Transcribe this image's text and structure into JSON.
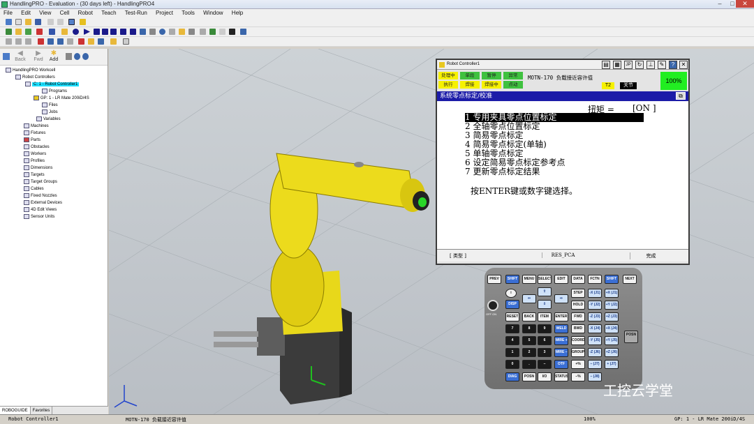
{
  "window": {
    "title": "HandlingPRO - Evaluation - (30 days left) - HandlingPRO4",
    "minimize": "–",
    "maximize": "□",
    "close": "✕"
  },
  "menu": [
    "File",
    "Edit",
    "View",
    "Cell",
    "Robot",
    "Teach",
    "Test-Run",
    "Project",
    "Tools",
    "Window",
    "Help"
  ],
  "nav": {
    "back": "Back",
    "fwd": "Fwd",
    "add": "Add"
  },
  "tree": {
    "workcell": "HandlingPRO Workcell",
    "robot_controllers": "Robot Controllers",
    "controller": "C: 1 - Robot Controller1",
    "programs": "Programs",
    "gp": "GP: 1 - LR Mate 200iD/4S",
    "files": "Files",
    "jobs": "Jobs",
    "variables": "Variables",
    "machines": "Machines",
    "fixtures": "Fixtures",
    "parts": "Parts",
    "obstacles": "Obstacles",
    "workers": "Workers",
    "profiles": "Profiles",
    "dimensions": "Dimensions",
    "targets": "Targets",
    "target_groups": "Target Groups",
    "cables": "Cables",
    "fixed_nozzles": "Fixed Nozzles",
    "external_devices": "External Devices",
    "edit_views": "4D Edit Views",
    "sensor_units": "Sensor Units"
  },
  "tabs": {
    "roboguide": "ROBOGUIDE",
    "favorites": "Favorites"
  },
  "tp": {
    "title": "Robot Controller1",
    "status": {
      "busy": "处理中",
      "step": "单段",
      "hold": "暂停",
      "fault": "异常",
      "run": "执行",
      "weld": "焊接",
      "welding": "焊接中",
      "jog": "点动"
    },
    "alarm": "MOTN-170 负载接近容许值",
    "t2": "T2",
    "mode": "关节",
    "override": "100%",
    "screen_title": "系统零点标定/校准",
    "torque_label": "扭矩 =",
    "torque_value": "[ON ]",
    "items": [
      "1 专用夹具零点位置标定",
      "2 全轴零点位置标定",
      "3 简易零点标定",
      "4 简易零点标定(单轴)",
      "5 单轴零点标定",
      "6 设定简易零点标定参考点",
      "7 更新零点标定结果"
    ],
    "prompt": "按ENTER键或数字键选择。",
    "fkeys": [
      "[ 类型 ]",
      "",
      "RES_PCA",
      "",
      "完成"
    ]
  },
  "pendant": {
    "prev": "PREV",
    "shift": "SHIFT",
    "menu": "MENU",
    "select": "SELECT",
    "edit": "EDIT",
    "data": "DATA",
    "fctn": "FCTN",
    "next": "NEXT",
    "disp": "DISP",
    "step": "STEP",
    "hold": "HOLD",
    "fwd": "FWD",
    "bwd": "BWD",
    "reset": "RESET",
    "backspace": "BACK SPACE",
    "item": "ITEM",
    "enter": "ENTER",
    "weld": "WELD ENBL",
    "wire_plus": "WIRE +",
    "wire_minus": "WIRE −",
    "coord": "COORD",
    "group": "GROUP",
    "otf": "OTF",
    "diag": "DIAG HELP",
    "posn": "POSN",
    "io": "I/O",
    "status": "STATUS",
    "off_on": "OFF ON",
    "jx_minus": "-X (J1)",
    "jx_plus": "+X (J1)",
    "jy_minus": "-Y (J2)",
    "jy_plus": "+Y (J2)",
    "jz_minus": "-Z (J3)",
    "jz_plus": "+Z (J3)",
    "j4_minus": "-X (J4)",
    "j4_plus": "+X (J4)",
    "j5_minus": "-Y (J5)",
    "j5_plus": "+Y (J5)",
    "j6_minus": "-Z (J6)",
    "j6_plus": "+Z (J6)",
    "j7_minus": "– (J7)",
    "j7_plus": "+ (J7)",
    "j8_minus": "– (J8)",
    "j8_plus": "+ (J8)",
    "side_posn": "POSN",
    "nums": [
      "7",
      "8",
      "9",
      "4",
      "5",
      "6",
      "1",
      "2",
      "3",
      "0",
      ".",
      "–"
    ]
  },
  "status": {
    "controller": "Robot Controller1",
    "alarm": "MOTN-170 负载接近容许值",
    "override": "100%",
    "group": "GP: 1 - LR Mate 200iD/4S"
  },
  "watermark": "工控云学堂"
}
